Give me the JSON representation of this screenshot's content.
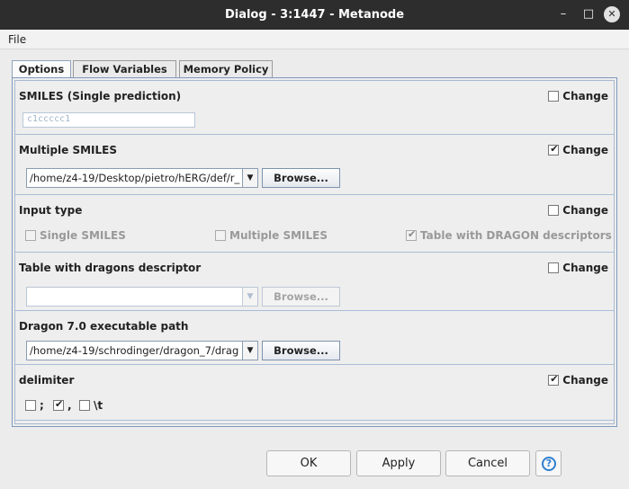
{
  "window": {
    "title": "Dialog - 3:1447 - Metanode",
    "minimize_glyph": "–",
    "maximize_glyph": "□",
    "close_glyph": "✕"
  },
  "menubar": {
    "file": "File"
  },
  "tabs": [
    {
      "label": "Options",
      "active": true
    },
    {
      "label": "Flow Variables",
      "active": false
    },
    {
      "label": "Memory Policy",
      "active": false
    }
  ],
  "sections": {
    "smiles_single": {
      "title": "SMILES (Single prediction)",
      "change_label": "Change",
      "change_checked": false,
      "value": "c1ccccc1"
    },
    "multiple_smiles": {
      "title": "Multiple SMILES",
      "change_label": "Change",
      "change_checked": true,
      "path": "/home/z4-19/Desktop/pietro/hERG/def/r_",
      "browse_label": "Browse..."
    },
    "input_type": {
      "title": "Input type",
      "change_label": "Change",
      "change_checked": false,
      "options": [
        {
          "label": "Single SMILES",
          "checked": false
        },
        {
          "label": "Multiple SMILES",
          "checked": false
        },
        {
          "label": "Table with DRAGON descriptors",
          "checked": true
        }
      ]
    },
    "dragons_table": {
      "title": "Table with dragons descriptor",
      "change_label": "Change",
      "change_checked": false,
      "path": "",
      "browse_label": "Browse..."
    },
    "dragon_path": {
      "title": "Dragon 7.0 executable path",
      "path": "/home/z4-19/schrodinger/dragon_7/drag",
      "browse_label": "Browse..."
    },
    "delimiter": {
      "title": "delimiter",
      "change_label": "Change",
      "change_checked": true,
      "options": [
        {
          "label": ";",
          "checked": false
        },
        {
          "label": ",",
          "checked": true
        },
        {
          "label": "\\t",
          "checked": false
        }
      ]
    }
  },
  "buttons": {
    "ok": "OK",
    "apply": "Apply",
    "cancel": "Cancel",
    "help_glyph": "?"
  },
  "colors": {
    "titlebar": "#2d2d2d",
    "panel_border": "#7f99bd",
    "help_blue": "#2f7fd1"
  },
  "icons": {
    "combo_arrow": "▼"
  }
}
